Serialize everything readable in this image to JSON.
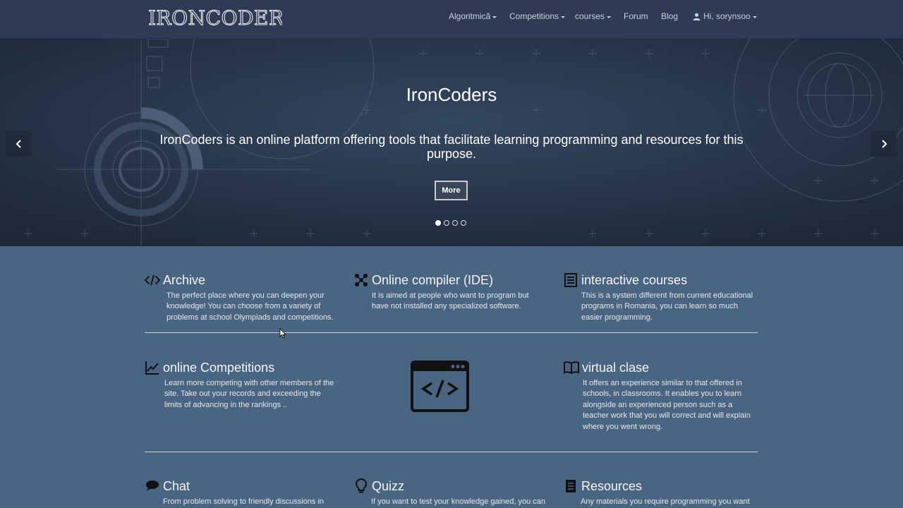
{
  "navbar": {
    "brand": "IRONCODERS",
    "items": [
      {
        "label": "Algoritmică",
        "dropdown": true
      },
      {
        "label": "Competitions",
        "dropdown": true
      },
      {
        "label": "courses",
        "dropdown": true
      },
      {
        "label": "Forum",
        "dropdown": false
      },
      {
        "label": "Blog",
        "dropdown": false
      }
    ],
    "user": {
      "label": "Hi, sorynsoo",
      "icon": "user-icon",
      "dropdown": true
    }
  },
  "hero": {
    "title": "IronCoders",
    "text": "IronCoders is an online platform offering tools that facilitate learning programming and resources for this purpose.",
    "button": "More",
    "slides_count": 4,
    "active_slide": 1
  },
  "features": [
    {
      "icon": "code-icon",
      "title": "Archive",
      "desc": "The perfect place where you can deepen your knowledge! You can choose from a variety of problems at school Olympiads and competitions."
    },
    {
      "icon": "network-icon",
      "title": "Online compiler (IDE)",
      "desc": "It is aimed at people who want to program but have not installed any specialized software."
    },
    {
      "icon": "list-icon",
      "title": "interactive courses",
      "desc": "This is a system different from current educational programs in Romania, you can learn so much easier programming."
    },
    {
      "icon": "chart-icon",
      "title": "online Competitions",
      "desc": "Learn more competing with other members of the site. Take out your records and exceeding the limits of advancing in the rankings .."
    },
    {
      "icon": "book-icon",
      "title": "virtual clase",
      "desc": "It offers an experience similar to that offered in schools, in classrooms. It enables you to learn alongside an experienced person such as a teacher work that you will correct and will explain where you went wrong."
    },
    {
      "icon": "comment-icon",
      "title": "Chat",
      "desc": "From problem solving to friendly discussions in real"
    },
    {
      "icon": "lightbulb-icon",
      "title": "Quizz",
      "desc": "If you want to test your knowledge gained, you can do"
    },
    {
      "icon": "document-icon",
      "title": "Resources",
      "desc": "Any materials you require programming you want to"
    }
  ],
  "colors": {
    "navbar": "#2f3a55",
    "hero": "#243246",
    "body": "#4a6582",
    "text": "#ffffff"
  }
}
